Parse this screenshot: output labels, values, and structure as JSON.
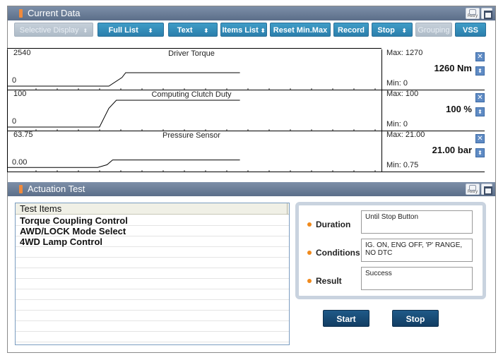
{
  "current_data": {
    "title": "Current Data",
    "retry_label": "Retry"
  },
  "toolbar": {
    "selective_display": "Selective Display",
    "full_list": "Full List",
    "text": "Text",
    "items_list": "Items List",
    "reset_min_max": "Reset Min.Max",
    "record": "Record",
    "stop": "Stop",
    "grouping": "Grouping",
    "vss": "VSS"
  },
  "graphs": [
    {
      "name": "Driver Torque",
      "axis_max": "2540",
      "axis_min": "0",
      "max": "Max: 1270",
      "min": "Min:  0",
      "current": "1260 Nm",
      "trace": [
        [
          0,
          0
        ],
        [
          0.27,
          0
        ],
        [
          0.305,
          0.32
        ],
        [
          0.315,
          0.5
        ],
        [
          0.62,
          0.5
        ]
      ]
    },
    {
      "name": "Computing Clutch Duty",
      "axis_max": "100",
      "axis_min": "0",
      "max": "Max: 100",
      "min": "Min:  0",
      "current": "100 %",
      "trace": [
        [
          0,
          0
        ],
        [
          0.245,
          0
        ],
        [
          0.27,
          0.7
        ],
        [
          0.29,
          1
        ],
        [
          0.62,
          1
        ]
      ]
    },
    {
      "name": "Pressure Sensor",
      "axis_max": "63.75",
      "axis_min": "0.00",
      "max": "Max: 21.00",
      "min": "Min:  0.75",
      "current": "21.00 bar",
      "trace": [
        [
          0,
          0.02
        ],
        [
          0.24,
          0.02
        ],
        [
          0.265,
          0.12
        ],
        [
          0.28,
          0.3
        ],
        [
          0.62,
          0.3
        ]
      ]
    }
  ],
  "actuation": {
    "title": "Actuation Test",
    "list_header": "Test Items",
    "items": [
      "Torque Coupling Control",
      "AWD/LOCK Mode Select",
      "4WD Lamp Control"
    ],
    "duration_label": "Duration",
    "duration_value": "Until Stop Button",
    "conditions_label": "Conditions",
    "conditions_value": "IG. ON, ENG OFF, 'P' RANGE, NO DTC",
    "result_label": "Result",
    "result_value": "Success",
    "start_button": "Start",
    "stop_button": "Stop"
  },
  "colors": {
    "titlebar": "#5b6e89",
    "toolbar_button": "#2b7fac",
    "action_button": "#123d63",
    "accent_orange": "#f08a3c"
  },
  "icons": {
    "retry": "retry-icon",
    "restore": "restore-window-icon",
    "close": "close-icon",
    "stepper": "up-down-arrow-icon",
    "bullet": "orange-dot-icon"
  }
}
